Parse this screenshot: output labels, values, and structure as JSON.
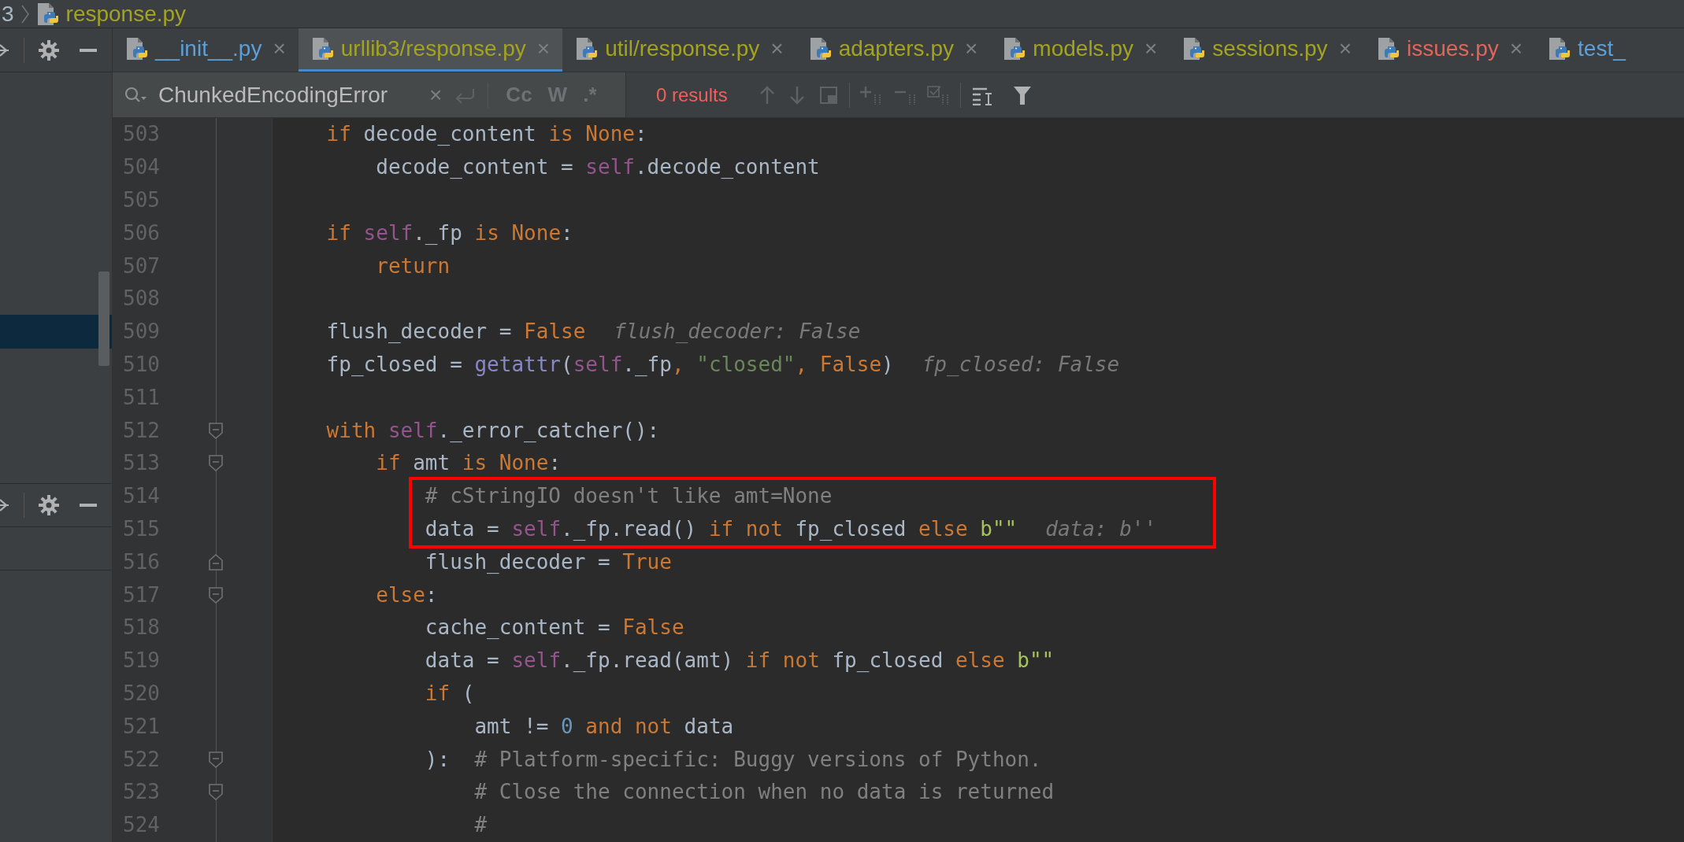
{
  "breadcrumb": {
    "segments": [
      "3",
      "response.py"
    ]
  },
  "tabs": [
    {
      "label": "__init__.py",
      "color": "#5e9fd6",
      "selected": false,
      "close": "×"
    },
    {
      "label": "urllib3/response.py",
      "color": "#a3a322",
      "selected": true,
      "close": "×"
    },
    {
      "label": "util/response.py",
      "color": "#a3a322",
      "selected": false,
      "close": "×"
    },
    {
      "label": "adapters.py",
      "color": "#a3a322",
      "selected": false,
      "close": "×"
    },
    {
      "label": "models.py",
      "color": "#a3a322",
      "selected": false,
      "close": "×"
    },
    {
      "label": "sessions.py",
      "color": "#a3a322",
      "selected": false,
      "close": "×"
    },
    {
      "label": "issues.py",
      "color": "#e0665c",
      "selected": false,
      "close": "×"
    },
    {
      "label": "test_",
      "color": "#5e9fd6",
      "selected": false
    }
  ],
  "search": {
    "value": "ChunkedEncodingError",
    "clear": "×",
    "options": [
      {
        "label": "Cc",
        "selected": false
      },
      {
        "label": "W",
        "selected": false
      },
      {
        "label": ".*",
        "selected": false
      }
    ],
    "results": "0 results"
  },
  "lines": [
    {
      "number": "503",
      "boxed": false,
      "code": [
        {
          "kind": "kw",
          "text": "    if"
        },
        {
          "kind": "plain",
          "text": " decode_content "
        },
        {
          "kind": "kw",
          "text": "is "
        },
        {
          "kind": "kw",
          "text": "None"
        },
        {
          "kind": "plain",
          "text": ":"
        }
      ]
    },
    {
      "number": "504",
      "boxed": false,
      "code": [
        {
          "kind": "plain",
          "text": "        decode_content = "
        },
        {
          "kind": "self",
          "text": "self"
        },
        {
          "kind": "plain",
          "text": ".decode_content"
        }
      ]
    },
    {
      "number": "505",
      "boxed": false
    },
    {
      "number": "506",
      "boxed": false,
      "code": [
        {
          "kind": "kw",
          "text": "    if "
        },
        {
          "kind": "self",
          "text": "self"
        },
        {
          "kind": "plain",
          "text": "._fp "
        },
        {
          "kind": "kw",
          "text": "is None"
        },
        {
          "kind": "plain",
          "text": ":"
        }
      ]
    },
    {
      "number": "507",
      "boxed": false,
      "code": [
        {
          "kind": "kw",
          "text": "        return"
        }
      ]
    },
    {
      "number": "508",
      "boxed": false
    },
    {
      "number": "509",
      "boxed": false,
      "code": [
        {
          "kind": "plain",
          "text": "    flush_decoder = "
        },
        {
          "kind": "kw",
          "text": "False"
        }
      ],
      "hint": "flush_decoder: False"
    },
    {
      "number": "510",
      "boxed": false,
      "code": [
        {
          "kind": "plain",
          "text": "    fp_closed = "
        },
        {
          "kind": "fn",
          "text": "getattr"
        },
        {
          "kind": "plain",
          "text": "("
        },
        {
          "kind": "self",
          "text": "self"
        },
        {
          "kind": "plain",
          "text": "._fp"
        },
        {
          "kind": "kw",
          "text": ", "
        },
        {
          "kind": "str",
          "text": "\"closed\""
        },
        {
          "kind": "kw",
          "text": ", False"
        },
        {
          "kind": "plain",
          "text": ")"
        }
      ],
      "hint": "fp_closed: False"
    },
    {
      "number": "511",
      "boxed": false
    },
    {
      "number": "512",
      "marker": {
        "kind": "start"
      },
      "boxed": false,
      "code": [
        {
          "kind": "kw",
          "text": "    with "
        },
        {
          "kind": "self",
          "text": "self"
        },
        {
          "kind": "plain",
          "text": "._error_catcher():"
        }
      ]
    },
    {
      "number": "513",
      "marker": {
        "kind": "start"
      },
      "boxed": false,
      "code": [
        {
          "kind": "kw",
          "text": "        if"
        },
        {
          "kind": "plain",
          "text": " amt "
        },
        {
          "kind": "kw",
          "text": "is None"
        },
        {
          "kind": "plain",
          "text": ":"
        }
      ]
    },
    {
      "number": "514",
      "boxed": true,
      "code": [
        {
          "kind": "comment",
          "text": "            # cStringIO doesn't like amt=None"
        }
      ]
    },
    {
      "number": "515",
      "boxed": true,
      "code": [
        {
          "kind": "plain",
          "text": "            data = "
        },
        {
          "kind": "self",
          "text": "self"
        },
        {
          "kind": "plain",
          "text": "._fp.read() "
        },
        {
          "kind": "kw",
          "text": "if not"
        },
        {
          "kind": "plain",
          "text": " fp_closed "
        },
        {
          "kind": "kw",
          "text": "else "
        },
        {
          "kind": "bytes",
          "text": "b\"\""
        }
      ],
      "hint": "data: b''"
    },
    {
      "number": "516",
      "marker": {
        "kind": "end"
      },
      "boxed": false,
      "code": [
        {
          "kind": "plain",
          "text": "            flush_decoder = "
        },
        {
          "kind": "kw",
          "text": "True"
        }
      ]
    },
    {
      "number": "517",
      "marker": {
        "kind": "start"
      },
      "boxed": false,
      "code": [
        {
          "kind": "kw",
          "text": "        else"
        },
        {
          "kind": "plain",
          "text": ":"
        }
      ]
    },
    {
      "number": "518",
      "boxed": false,
      "code": [
        {
          "kind": "plain",
          "text": "            cache_content = "
        },
        {
          "kind": "kw",
          "text": "False"
        }
      ]
    },
    {
      "number": "519",
      "boxed": false,
      "code": [
        {
          "kind": "plain",
          "text": "            data = "
        },
        {
          "kind": "self",
          "text": "self"
        },
        {
          "kind": "plain",
          "text": "._fp.read(amt) "
        },
        {
          "kind": "kw",
          "text": "if not"
        },
        {
          "kind": "plain",
          "text": " fp_closed "
        },
        {
          "kind": "kw",
          "text": "else "
        },
        {
          "kind": "bytes",
          "text": "b\"\""
        }
      ]
    },
    {
      "number": "520",
      "boxed": false,
      "code": [
        {
          "kind": "kw",
          "text": "            if"
        },
        {
          "kind": "plain",
          "text": " ("
        }
      ]
    },
    {
      "number": "521",
      "boxed": false,
      "code": [
        {
          "kind": "plain",
          "text": "                amt != "
        },
        {
          "kind": "num",
          "text": "0"
        },
        {
          "kind": "kw",
          "text": " and not"
        },
        {
          "kind": "plain",
          "text": " data"
        }
      ]
    },
    {
      "number": "522",
      "marker": {
        "kind": "start"
      },
      "boxed": false,
      "code": [
        {
          "kind": "plain",
          "text": "            ):  "
        },
        {
          "kind": "comment",
          "text": "# Platform-specific: Buggy versions of Python."
        }
      ]
    },
    {
      "number": "523",
      "marker": {
        "kind": "start"
      },
      "boxed": false,
      "code": [
        {
          "kind": "comment",
          "text": "                # Close the connection when no data is returned"
        }
      ]
    },
    {
      "number": "524",
      "boxed": false,
      "code": [
        {
          "kind": "comment",
          "text": "                #"
        }
      ]
    }
  ]
}
